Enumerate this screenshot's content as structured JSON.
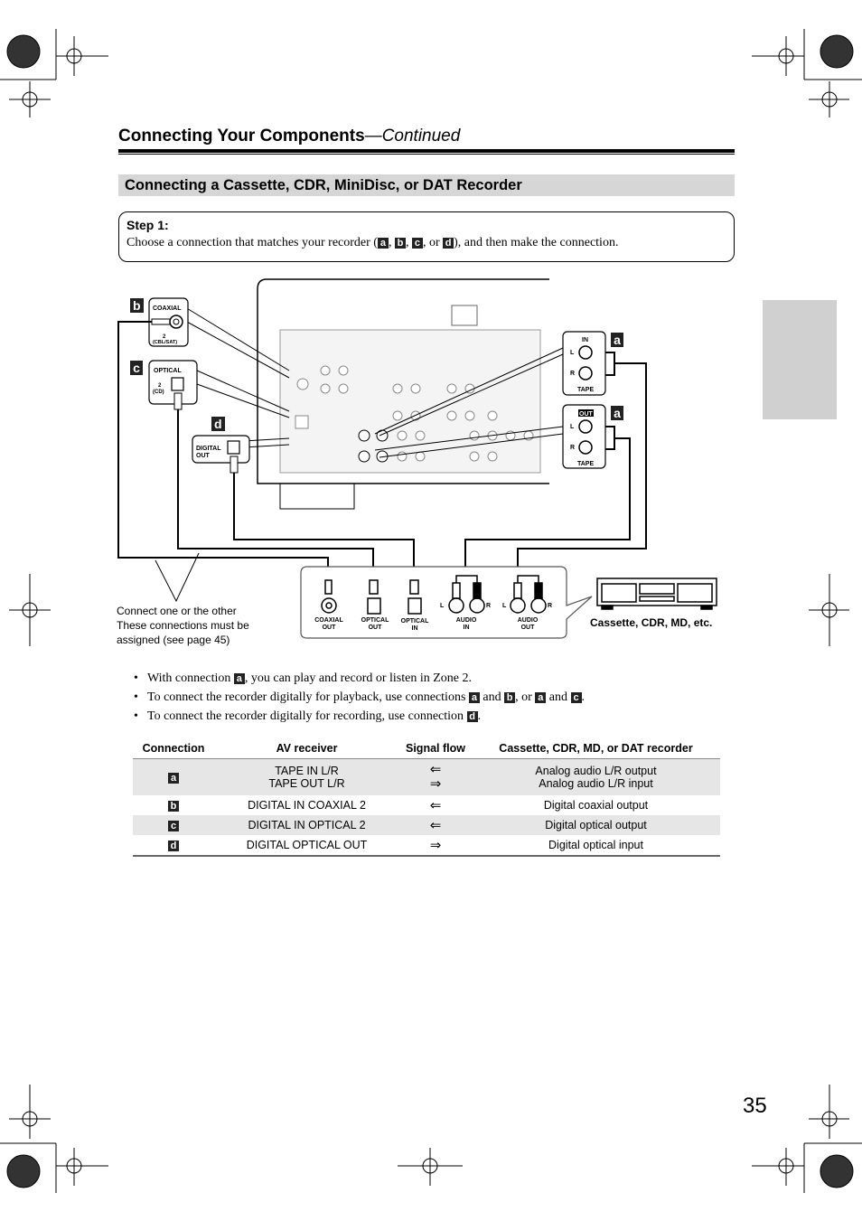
{
  "header": {
    "title": "Connecting Your Components",
    "continued": "—Continued"
  },
  "section_title": "Connecting a Cassette, CDR, MiniDisc, or DAT Recorder",
  "step": {
    "label": "Step 1:",
    "text_before": "Choose a connection that matches your recorder (",
    "sep1": ", ",
    "sep2": ", ",
    "sep3": ", or ",
    "text_after": "), and then make the connection."
  },
  "badges": {
    "a": "a",
    "b": "b",
    "c": "c",
    "d": "d"
  },
  "diagram": {
    "coaxial_label": "COAXIAL",
    "coaxial_num": "2",
    "coaxial_sub": "(CBL/SAT)",
    "optical_label": "OPTICAL",
    "optical_num": "2",
    "optical_sub": "(CD)",
    "digital_out": "DIGITAL",
    "digital_out2": "OUT",
    "tape_in": "IN",
    "tape_out": "OUT",
    "tape": "TAPE",
    "L": "L",
    "R": "R",
    "rec_jacks": [
      {
        "l1": "COAXIAL",
        "l2": "OUT"
      },
      {
        "l1": "OPTICAL",
        "l2": "OUT"
      },
      {
        "l1": "OPTICAL",
        "l2": "IN"
      },
      {
        "l1": "AUDIO",
        "l2": "IN"
      },
      {
        "l1": "AUDIO",
        "l2": "OUT"
      }
    ],
    "device_label": "Cassette, CDR, MD, etc.",
    "note": [
      "Connect one or the other",
      "These connections must be",
      "assigned (see page 45)"
    ]
  },
  "bullets": [
    {
      "before": "With connection ",
      "b1": "a",
      "after": ", you can play and record or listen in Zone 2."
    },
    {
      "before": "To connect the recorder digitally for playback, use connections ",
      "b1": "a",
      "mid1": " and ",
      "b2": "b",
      "mid2": ", or ",
      "b3": "a",
      "mid3": " and ",
      "b4": "c",
      "after": "."
    },
    {
      "before": "To connect the recorder digitally for recording, use connection ",
      "b1": "d",
      "after": "."
    }
  ],
  "table": {
    "headers": [
      "Connection",
      "AV receiver",
      "Signal flow",
      "Cassette, CDR, MD, or DAT recorder"
    ],
    "rows": [
      {
        "conn": "a",
        "recv": [
          "TAPE IN L/R",
          "TAPE OUT L/R"
        ],
        "flow": [
          "⇐",
          "⇒"
        ],
        "rec": [
          "Analog audio L/R output",
          "Analog audio L/R input"
        ]
      },
      {
        "conn": "b",
        "recv": "DIGITAL IN COAXIAL 2",
        "flow": "⇐",
        "rec": "Digital coaxial output"
      },
      {
        "conn": "c",
        "recv": "DIGITAL IN OPTICAL 2",
        "flow": "⇐",
        "rec": "Digital optical output"
      },
      {
        "conn": "d",
        "recv": "DIGITAL OPTICAL OUT",
        "flow": "⇒",
        "rec": "Digital optical input"
      }
    ]
  },
  "page_number": "35"
}
